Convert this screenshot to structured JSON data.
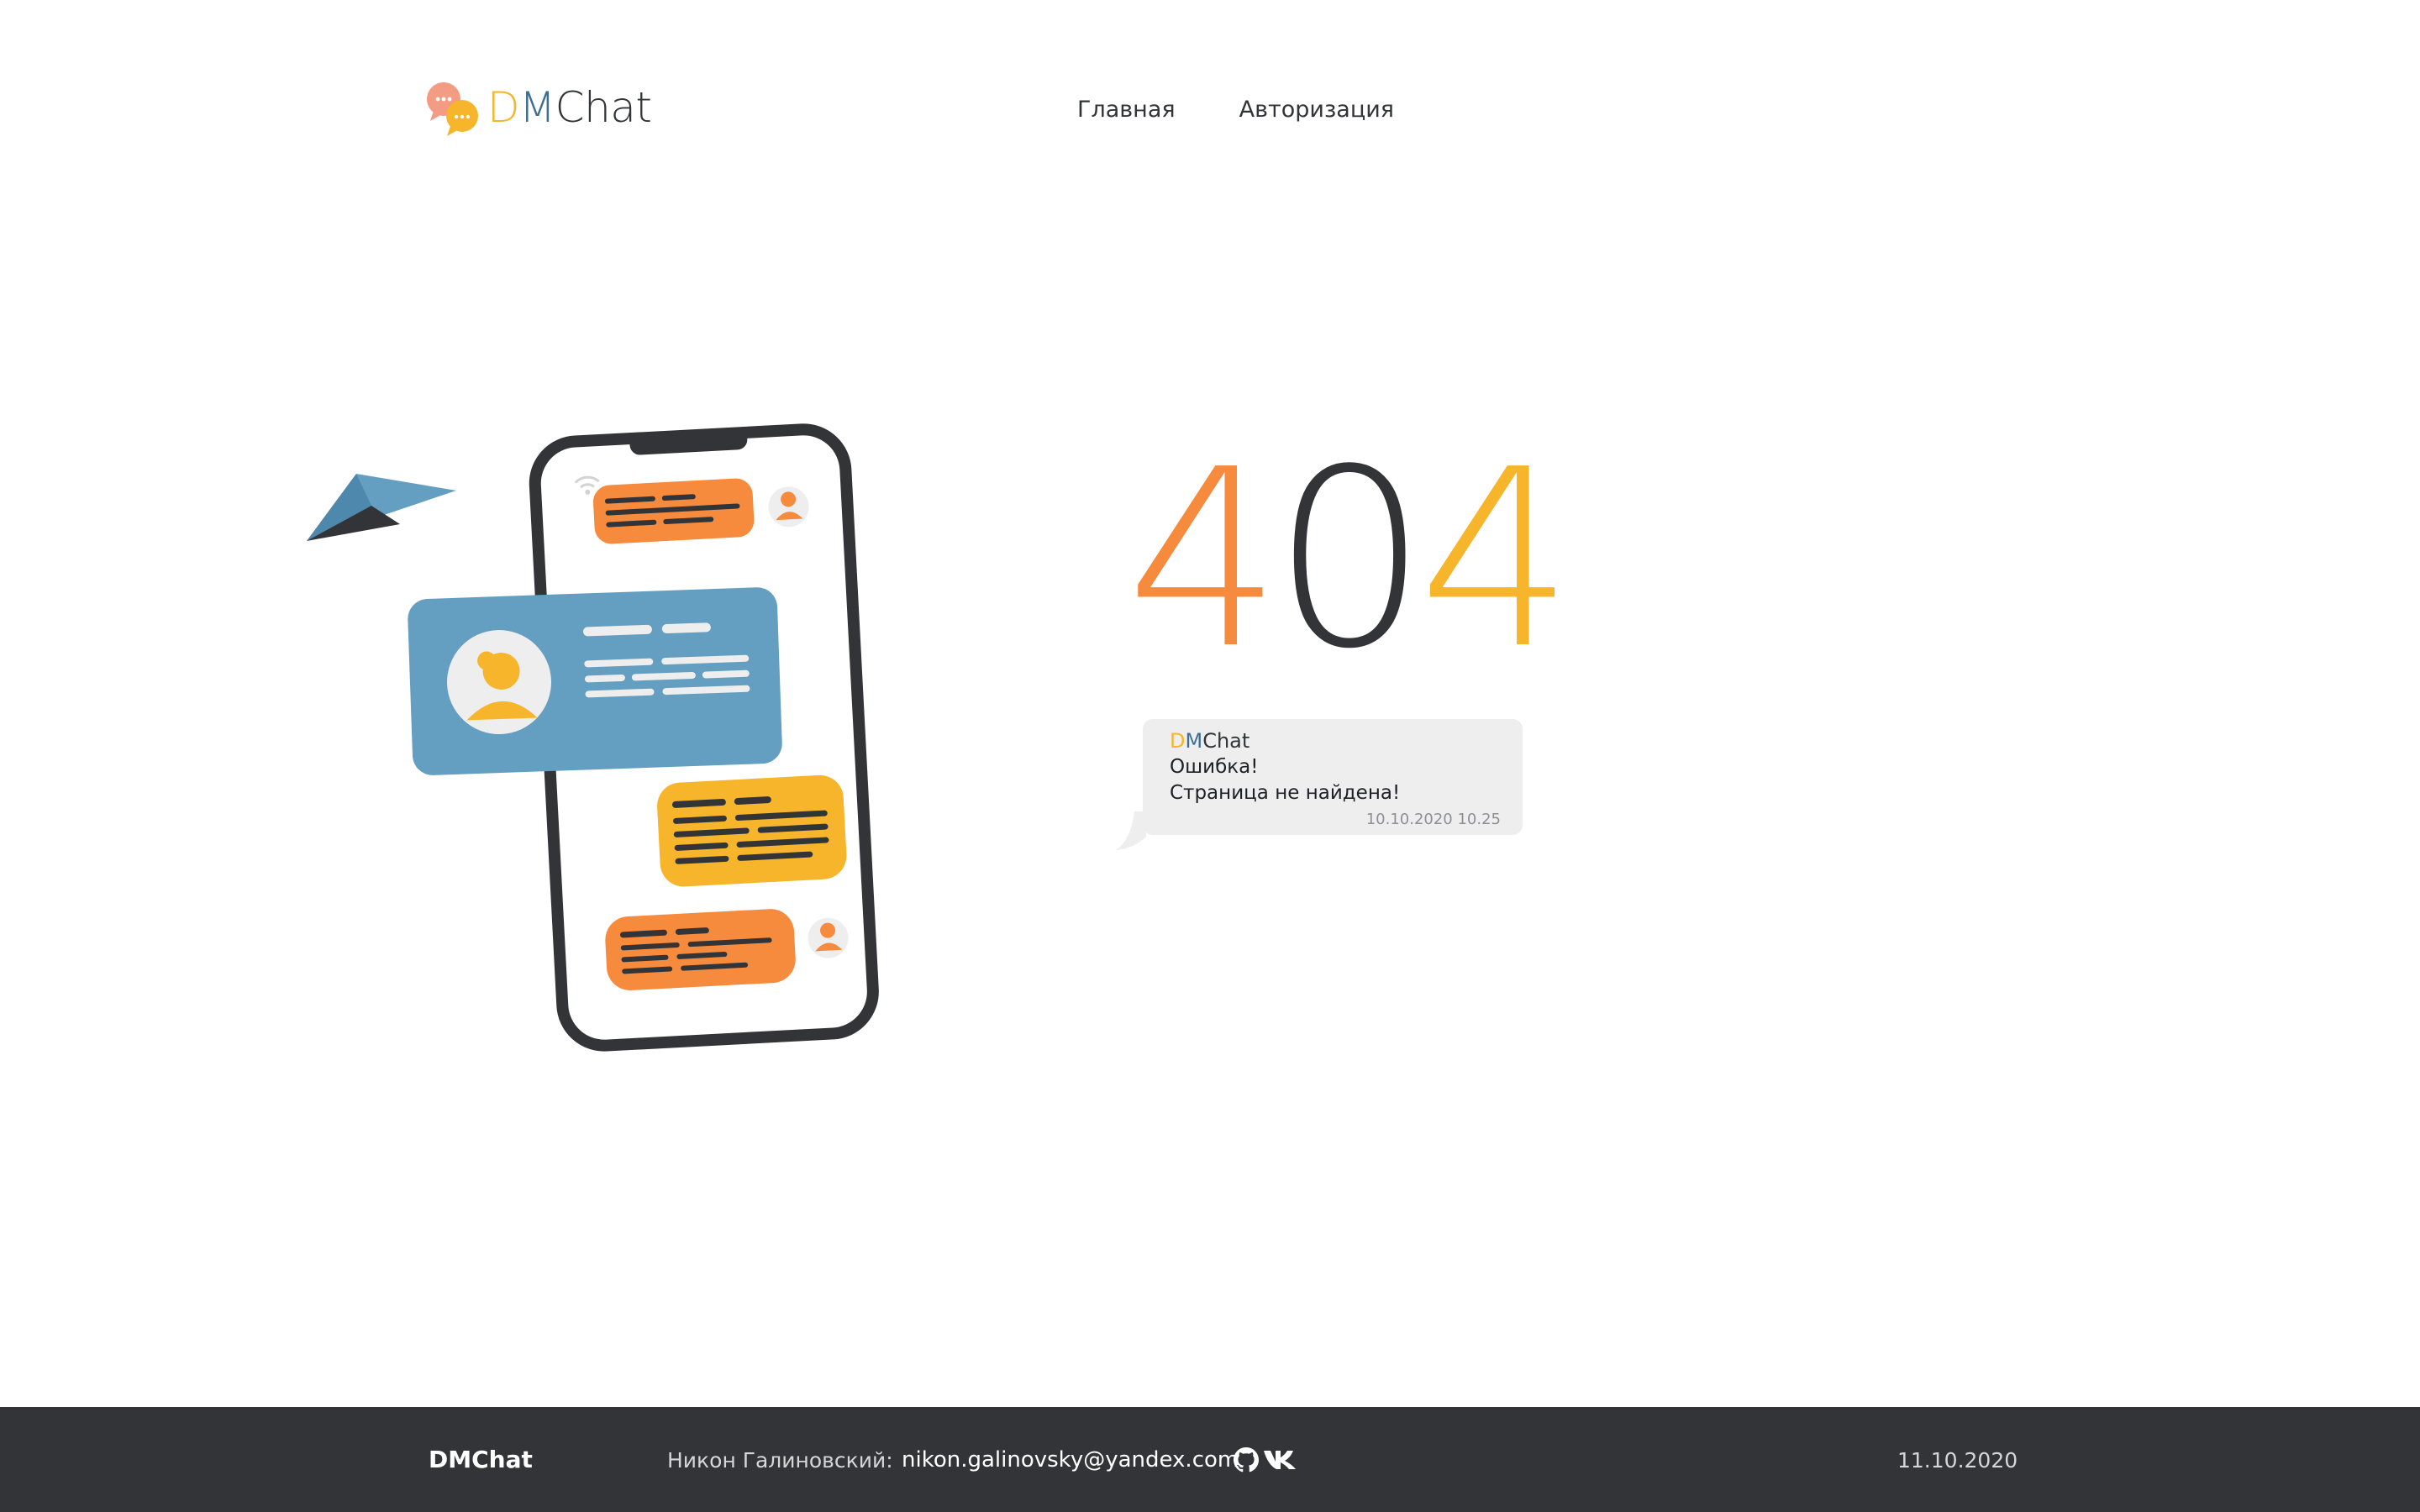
{
  "header": {
    "logo": {
      "d": "D",
      "m": "M",
      "c": "Chat"
    },
    "nav": [
      {
        "label": "Главная"
      },
      {
        "label": "Авторизация"
      }
    ]
  },
  "error": {
    "digits": [
      "4",
      "0",
      "4"
    ]
  },
  "message": {
    "sender": {
      "d": "D",
      "m": "M",
      "c": "Chat"
    },
    "lines": [
      "Ошибка!",
      "Страница не найдена!"
    ],
    "time": "10.10.2020 10.25"
  },
  "footer": {
    "brand": "DMChat",
    "author": "Никон Галиновский:",
    "email": "nikon.galinovsky@yandex.com",
    "icons": [
      "github-icon",
      "vk-icon"
    ],
    "date": "11.10.2020"
  },
  "colors": {
    "orange": "#f68a3d",
    "yellow": "#f6b52b",
    "blue": "#649fc1",
    "dark": "#323438",
    "bubble": "#eeeeee"
  }
}
